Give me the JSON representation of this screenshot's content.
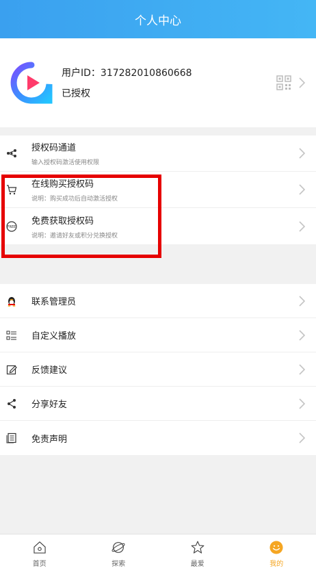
{
  "header": {
    "title": "个人中心"
  },
  "profile": {
    "user_id": "用户ID：317282010860668",
    "auth_status": "已授权"
  },
  "auth_section": [
    {
      "title": "授权码通道",
      "subtitle": "输入授权码激活使用权限",
      "icon": "link-nodes-icon"
    },
    {
      "title": "在线购买授权码",
      "subtitle": "说明：购买成功后自动激活授权",
      "icon": "cart-icon"
    },
    {
      "title": "免费获取授权码",
      "subtitle": "说明：邀请好友或积分兑换授权",
      "icon": "free-badge-icon"
    }
  ],
  "settings_section": [
    {
      "title": "联系管理员",
      "icon": "qq-penguin-icon"
    },
    {
      "title": "自定义播放",
      "icon": "list-custom-icon"
    },
    {
      "title": "反馈建议",
      "icon": "edit-icon"
    },
    {
      "title": "分享好友",
      "icon": "share-icon"
    },
    {
      "title": "免责声明",
      "icon": "document-icon"
    }
  ],
  "tabbar": {
    "active_color": "#f5a623",
    "tabs": [
      {
        "label": "首页",
        "icon": "home-icon"
      },
      {
        "label": "探索",
        "icon": "planet-icon"
      },
      {
        "label": "最爱",
        "icon": "star-icon"
      },
      {
        "label": "我的",
        "icon": "smiley-icon",
        "active": true
      }
    ]
  },
  "colors": {
    "header_start": "#3aa0ef",
    "header_end": "#44b6f5",
    "highlight_box": "#e60000"
  }
}
